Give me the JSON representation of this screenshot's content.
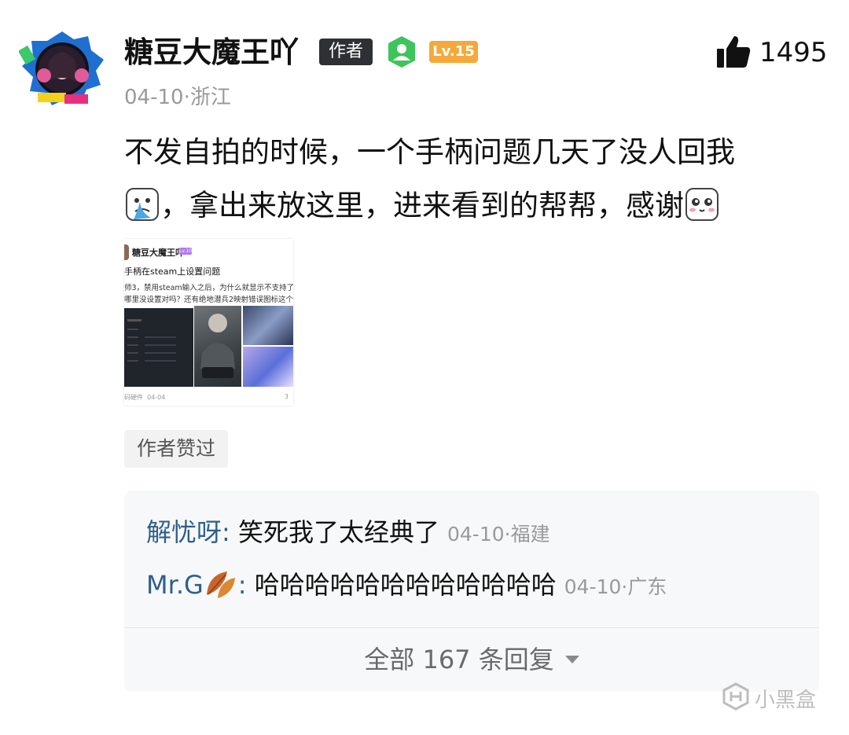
{
  "post": {
    "author": "糖豆大魔王吖",
    "author_badge": "作者",
    "level": "Lv.15",
    "like_count": "1495",
    "date": "04-10",
    "separator": "·",
    "location": "浙江",
    "text_line1": "不发自拍的时候，一个手柄问题几天了没人回我",
    "text_line2": "，拿出来放这里，进来看到的帮帮，感谢",
    "liked_by_author": "作者赞过"
  },
  "embedded_card": {
    "author": "糖豆大魔王吖",
    "level": "Lv.10",
    "title": "手柄在steam上设置问题",
    "line1": "师3，禁用steam输入之后，为什么就显示不支持了",
    "line2": "哪里没设置对吗？还有绝地潜兵2映射错误图标这个",
    "footer_tag": "码硬件",
    "footer_date": "04-04",
    "footer_comments": "3"
  },
  "replies": [
    {
      "name": "解忧呀",
      "colon": ": ",
      "text": "笑死我了太经典了",
      "date": "04-10",
      "sep": "·",
      "location": "福建"
    },
    {
      "name": "Mr.G",
      "colon": ": ",
      "text": "哈哈哈哈哈哈哈哈哈哈哈哈",
      "date": "04-10",
      "sep": "·",
      "location": "广东"
    }
  ],
  "all_replies_label": "全部 167 条回复",
  "watermark": "小黑盒",
  "icons": {
    "like": "thumbs-up-icon",
    "verified": "user-shield-icon",
    "expand": "caret-down-icon"
  },
  "colors": {
    "reply_name": "#2e5f8a",
    "level_badge": "#f5a93a",
    "author_badge": "#2f3033",
    "verified": "#3dc45a"
  }
}
